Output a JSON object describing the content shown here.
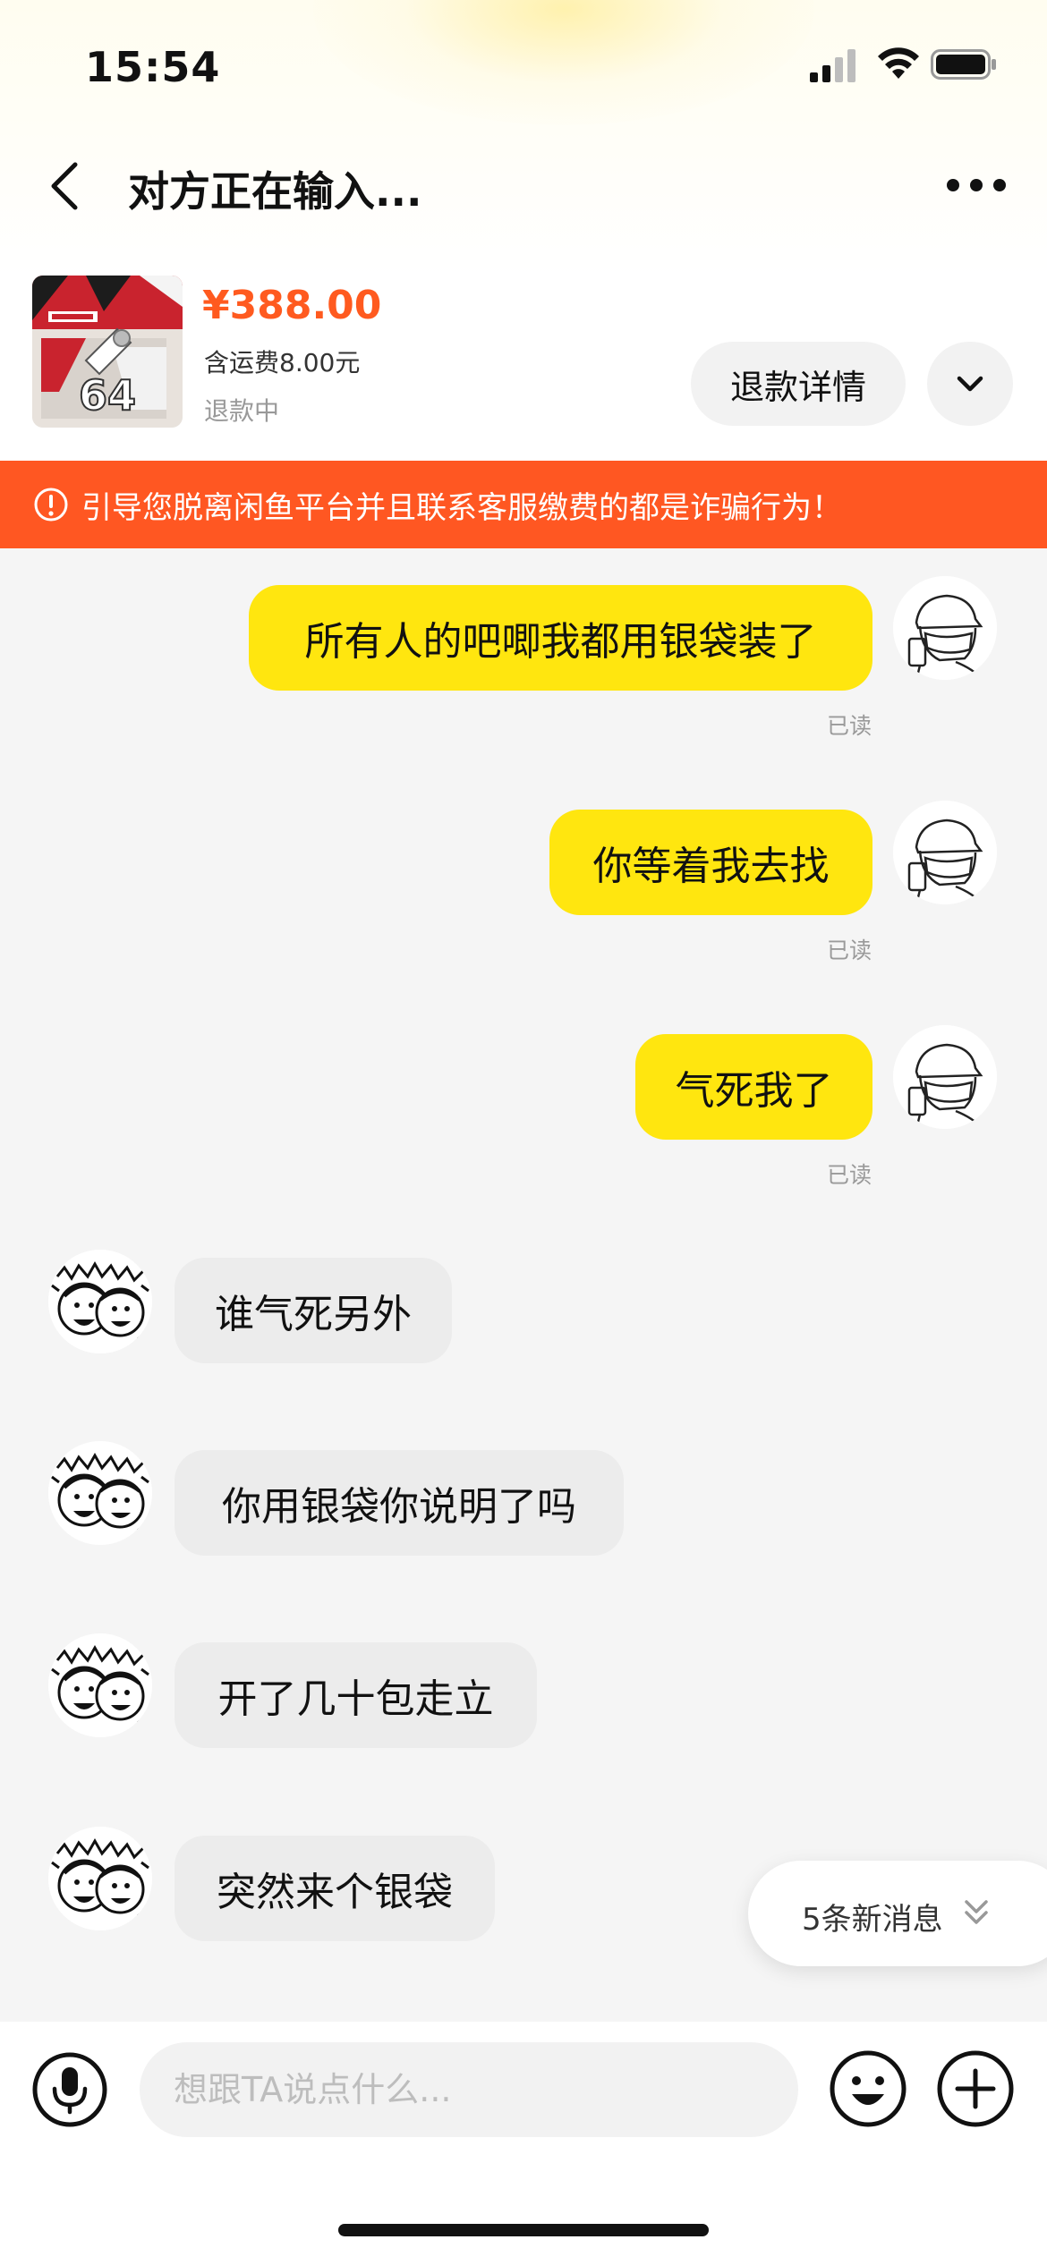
{
  "status_bar": {
    "time": "15:54",
    "icons": [
      "signal-icon",
      "wifi-icon",
      "battery-icon"
    ]
  },
  "nav": {
    "title": "对方正在输入...",
    "back_icon": "chevron-left-icon",
    "more_icon": "more-dots-icon"
  },
  "product": {
    "price": "¥388.00",
    "shipping": "含运费8.00元",
    "status": "退款中",
    "refund_button": "退款详情",
    "expand_icon": "chevron-down-icon"
  },
  "warning": {
    "text": "引导您脱离闲鱼平台并且联系客服缴费的都是诈骗行为！",
    "icon": "alert-circle-icon"
  },
  "messages": [
    {
      "from": "me",
      "text": "所有人的吧唧我都用银袋装了",
      "read": "已读"
    },
    {
      "from": "me",
      "text": "你等着我去找",
      "read": "已读"
    },
    {
      "from": "me",
      "text": "气死我了",
      "read": "已读"
    },
    {
      "from": "them",
      "text": "谁气死另外"
    },
    {
      "from": "them",
      "text": "你用银袋你说明了吗"
    },
    {
      "from": "them",
      "text": "开了几十包走立"
    },
    {
      "from": "them",
      "text": "突然来个银袋"
    }
  ],
  "new_messages": {
    "label": "5条新消息",
    "icon": "double-chevron-down-icon"
  },
  "input_bar": {
    "placeholder": "想跟TA说点什么...",
    "value": "",
    "icons": [
      "microphone-icon",
      "emoji-icon",
      "plus-icon"
    ]
  },
  "colors": {
    "accent_yellow": "#ffe60f",
    "price_orange": "#ff5a1f",
    "warning_bg": "#ff5722",
    "bubble_gray": "#ececec"
  }
}
